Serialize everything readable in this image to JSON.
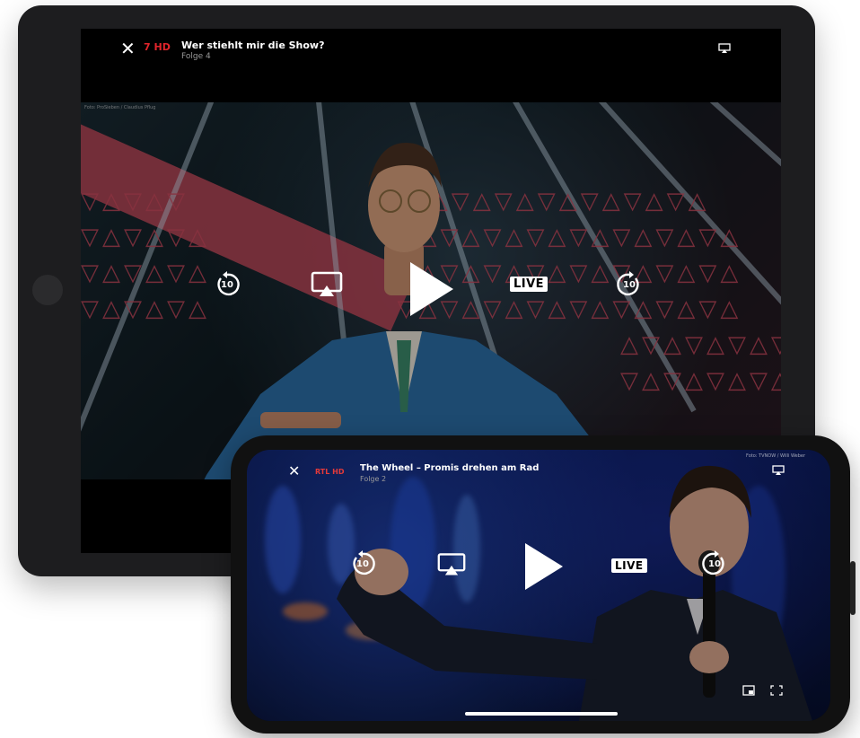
{
  "tablet": {
    "channel_logo": "7 HD",
    "title": "Wer stiehlt mir die Show?",
    "subtitle": "Folge 4",
    "photo_credit": "Foto: ProSieben / Claudius Pflug",
    "live_label": "LIVE",
    "skip_back_label": "10",
    "skip_forward_label": "10",
    "icons": [
      "close-icon",
      "airplay-icon",
      "rewind-10-icon",
      "cast-icon",
      "play-icon",
      "forward-10-icon"
    ]
  },
  "phone": {
    "channel_logo": "RTL HD",
    "title": "The Wheel – Promis drehen am Rad",
    "subtitle": "Folge 2",
    "photo_credit": "Foto: TVNOW / Willi Weber",
    "live_label": "LIVE",
    "skip_back_label": "10",
    "skip_forward_label": "10",
    "icons": [
      "close-icon",
      "airplay-icon",
      "rewind-10-icon",
      "cast-icon",
      "play-icon",
      "forward-10-icon",
      "pip-icon",
      "fullscreen-icon"
    ]
  },
  "colors": {
    "prosieben_red": "#e2252b",
    "live_badge_bg": "#ffffff",
    "device_frame": "#1d1d1f"
  }
}
